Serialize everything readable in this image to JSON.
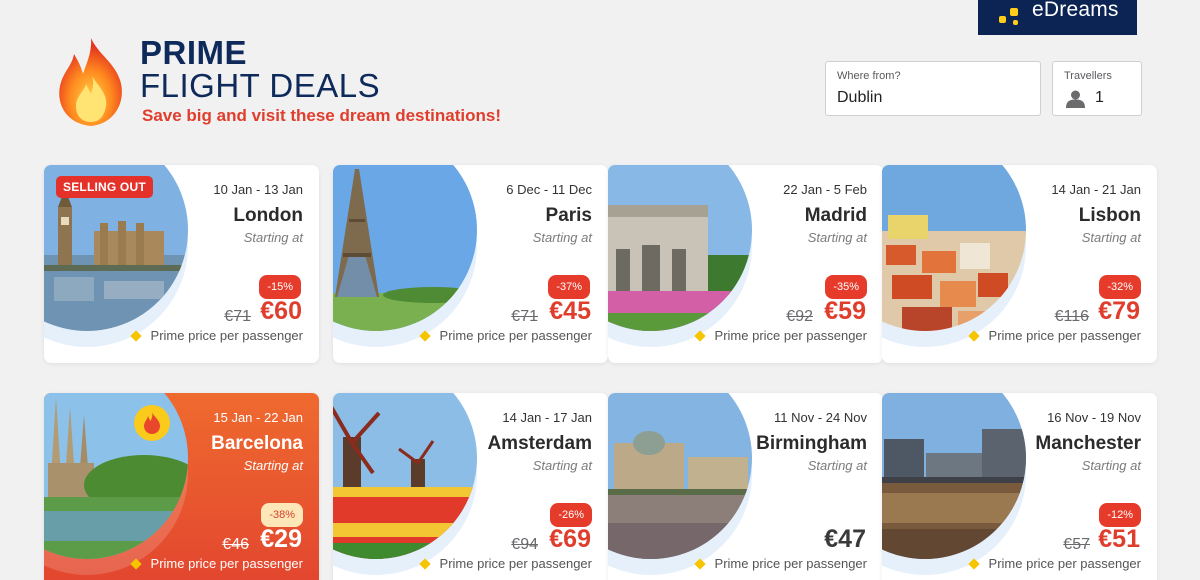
{
  "brand": {
    "name": "eDreams"
  },
  "header": {
    "title_line1": "PRIME",
    "title_line2": "FLIGHT DEALS",
    "tagline": "Save big and visit these dream destinations!"
  },
  "search": {
    "from_label": "Where from?",
    "from_value": "Dublin",
    "travellers_label": "Travellers",
    "travellers_value": "1"
  },
  "colors": {
    "accent": "#e03e2d",
    "navy": "#0d2a5a",
    "prime_gem": "#f6c400"
  },
  "deals": [
    {
      "dates": "10 Jan - 13 Jan",
      "city": "London",
      "starting": "Starting at",
      "discount": "-15%",
      "was": "€71",
      "now": "€60",
      "prime": "Prime price per passenger",
      "badge": "SELLING OUT"
    },
    {
      "dates": "6 Dec - 11 Dec",
      "city": "Paris",
      "starting": "Starting at",
      "discount": "-37%",
      "was": "€71",
      "now": "€45",
      "prime": "Prime price per passenger"
    },
    {
      "dates": "22 Jan - 5 Feb",
      "city": "Madrid",
      "starting": "Starting at",
      "discount": "-35%",
      "was": "€92",
      "now": "€59",
      "prime": "Prime price per passenger"
    },
    {
      "dates": "14 Jan - 21 Jan",
      "city": "Lisbon",
      "starting": "Starting at",
      "discount": "-32%",
      "was": "€116",
      "now": "€79",
      "prime": "Prime price per passenger"
    },
    {
      "dates": "15 Jan - 22 Jan",
      "city": "Barcelona",
      "starting": "Starting at",
      "discount": "-38%",
      "was": "€46",
      "now": "€29",
      "prime": "Prime price per passenger",
      "icon": "fire-icon"
    },
    {
      "dates": "14 Jan - 17 Jan",
      "city": "Amsterdam",
      "starting": "Starting at",
      "discount": "-26%",
      "was": "€94",
      "now": "€69",
      "prime": "Prime price per passenger"
    },
    {
      "dates": "11 Nov - 24 Nov",
      "city": "Birmingham",
      "starting": "Starting at",
      "now": "€47",
      "prime": "Prime price per passenger"
    },
    {
      "dates": "16 Nov - 19 Nov",
      "city": "Manchester",
      "starting": "Starting at",
      "discount": "-12%",
      "was": "€57",
      "now": "€51",
      "prime": "Prime price per passenger"
    }
  ]
}
